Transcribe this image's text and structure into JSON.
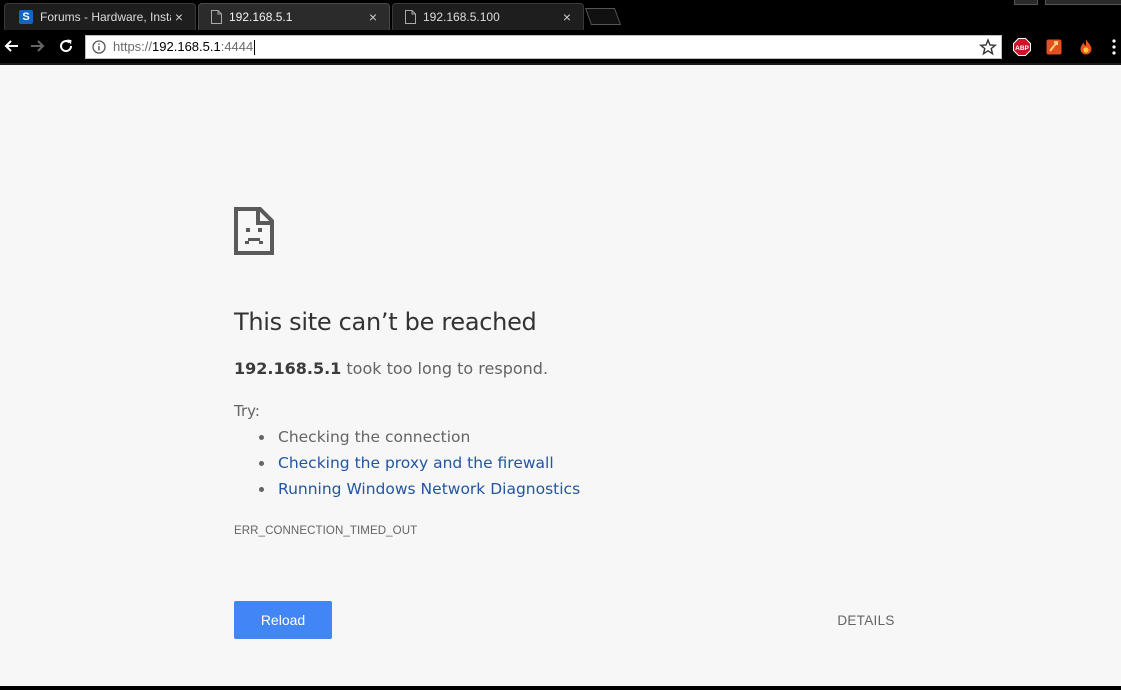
{
  "tabs": [
    {
      "title": "Forums - Hardware, Insta",
      "favicon": "s-logo-icon",
      "close": "×"
    },
    {
      "title": "192.168.5.1",
      "favicon": "page-icon",
      "close": "×",
      "active": true
    },
    {
      "title": "192.168.5.100",
      "favicon": "page-icon",
      "close": "×"
    }
  ],
  "toolbar": {
    "url_scheme": "https://",
    "url_host": "192.168.5.1",
    "url_port": ":4444",
    "extensions": [
      "adblock-plus-icon",
      "bookmark-extension-icon",
      "fire-extension-icon"
    ],
    "abp_label": "ABP"
  },
  "error_page": {
    "headline": "This site can’t be reached",
    "host": "192.168.5.1",
    "summary_rest": " took too long to respond.",
    "try_label": "Try:",
    "suggestions": [
      {
        "text": "Checking the connection",
        "link": false
      },
      {
        "text": "Checking the proxy and the firewall",
        "link": true
      },
      {
        "text": "Running Windows Network Diagnostics",
        "link": true
      }
    ],
    "error_code": "ERR_CONNECTION_TIMED_OUT",
    "reload_label": "Reload",
    "details_label": "DETAILS"
  },
  "colors": {
    "accent": "#4285f4",
    "link": "#2255a4",
    "page_bg": "#f7f7f7"
  }
}
